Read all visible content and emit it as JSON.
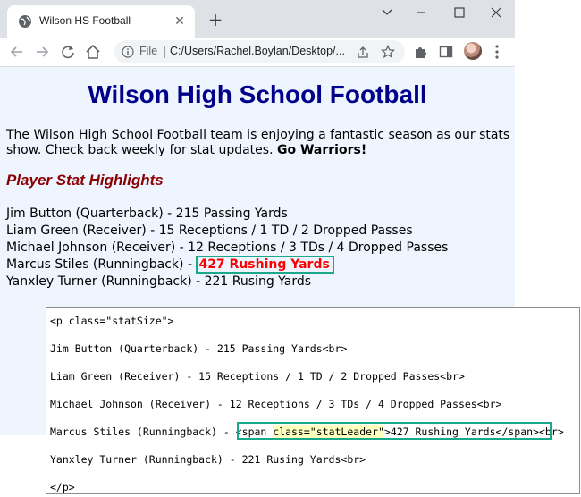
{
  "browser": {
    "tab_title": "Wilson HS Football",
    "tab_close": "✕",
    "new_tab": "+",
    "scheme_label": "File",
    "url": "C:/Users/Rachel.Boylan/Desktop/..."
  },
  "page": {
    "title": "Wilson High School Football",
    "intro_text": "The Wilson High School Football team is enjoying a fantastic season as our stats show. Check back weekly for stat updates.",
    "intro_bold": "Go Warriors!",
    "section_heading": "Player Stat Highlights",
    "stats": [
      "Jim Button (Quarterback) - 215 Passing Yards",
      "Liam Green (Receiver) - 15 Receptions / 1 TD / 2 Dropped Passes",
      "Michael Johnson (Receiver) - 12 Receptions / 3 TDs / 4 Dropped Passes",
      "Marcus Stiles (Runningback) - ",
      "Yanxley Turner (Runningback) - 221 Rusing Yards"
    ],
    "stat_leader": "427 Rushing Yards",
    "colors": {
      "title": "#00008b",
      "heading": "#8b0000",
      "leader": "#ff0000",
      "highlight_border": "#1aa88a",
      "page_bg": "#eef5fe"
    }
  },
  "code": {
    "line1": "<p class=\"statSize\">",
    "line2": "Jim Button (Quarterback) - 215 Passing Yards<br>",
    "line3": "Liam Green (Receiver) - 15 Receptions / 1 TD / 2 Dropped Passes<br>",
    "line4": "Michael Johnson (Receiver) - 12 Receptions / 3 TDs / 4 Dropped Passes<br>",
    "line5_prefix": "Marcus Stiles (Runningback) - ",
    "line5_span_open": "<span ",
    "line5_attr": "class=\"statLeader\"",
    "line5_span_rest": ">427 Rushing Yards</span>",
    "line5_suffix": "<br>",
    "line6": "Yanxley Turner (Runningback) - 221 Rusing Yards<br>",
    "line7": "</p>"
  }
}
